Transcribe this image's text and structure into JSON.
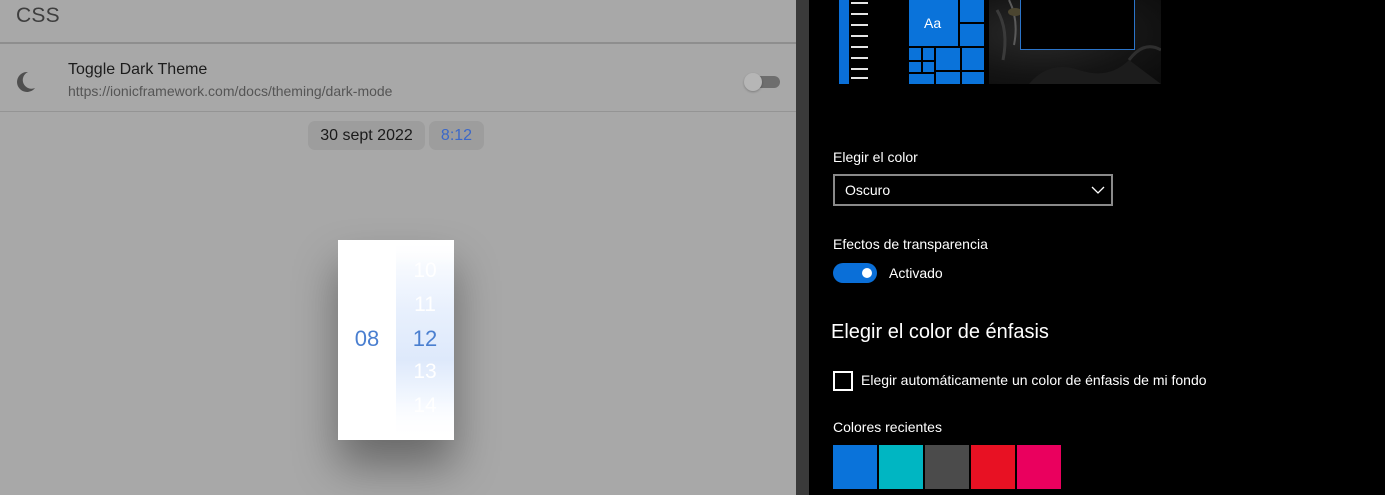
{
  "left_app": {
    "header_title": "CSS",
    "dark_theme_row": {
      "title": "Toggle Dark Theme",
      "url": "https://ionicframework.com/docs/theming/dark-mode",
      "icon": "moon-icon",
      "toggle_on": false
    },
    "datetime": {
      "date": "30 sept 2022",
      "time": "8:12"
    },
    "picker": {
      "hour_selected": "08",
      "minutes_visible": [
        "10",
        "11",
        "12",
        "13",
        "14"
      ],
      "minute_selected": "12"
    },
    "colors": {
      "background": "#a8a8a8",
      "accent": "#4a7fd0"
    }
  },
  "settings": {
    "choose_color_label": "Elegir el color",
    "color_mode_value": "Oscuro",
    "transparency_label": "Efectos de transparencia",
    "transparency_state": "Activado",
    "transparency_on": true,
    "accent_heading": "Elegir el color de énfasis",
    "auto_accent_label": "Elegir automáticamente un color de énfasis de mi fondo",
    "auto_accent_checked": false,
    "preview_tile_text": "Aa",
    "recent_colors_label": "Colores recientes",
    "recent_colors": [
      "#0a73da",
      "#00b6c2",
      "#4b4b4b",
      "#e81123",
      "#ea005e"
    ],
    "accent_color": "#0a6fd8"
  }
}
